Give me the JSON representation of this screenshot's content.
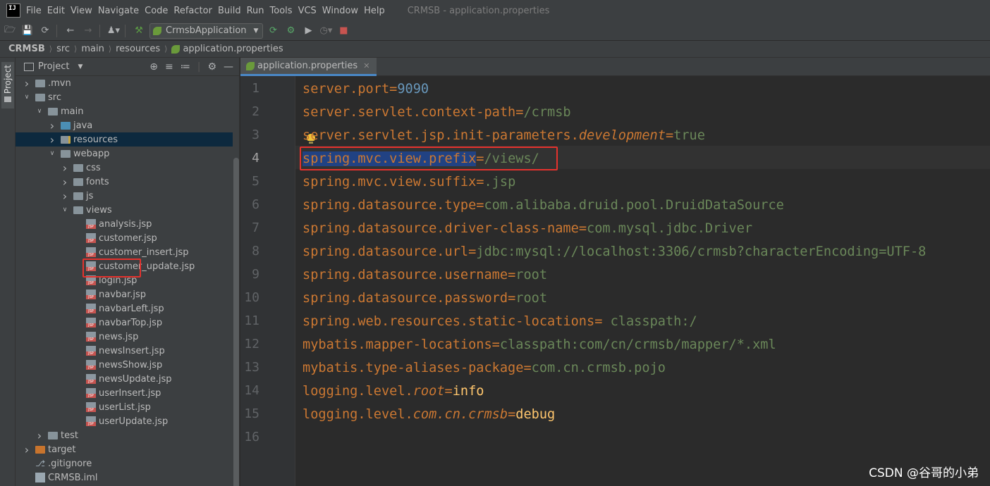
{
  "app": {
    "logo_text": "IJ",
    "window_title": "CRMSB - application.properties"
  },
  "menu": [
    "File",
    "Edit",
    "View",
    "Navigate",
    "Code",
    "Refactor",
    "Build",
    "Run",
    "Tools",
    "VCS",
    "Window",
    "Help"
  ],
  "toolbar": {
    "run_configuration": "CrmsbApplication",
    "icons": [
      "open-icon",
      "save-icon",
      "sync-icon",
      "back-icon",
      "forward-icon",
      "user-icon",
      "build-hammer-icon",
      "rerun-icon",
      "debug-icon",
      "coverage-icon",
      "profile-icon",
      "stop-icon"
    ]
  },
  "breadcrumb": [
    "CRMSB",
    "src",
    "main",
    "resources",
    "application.properties"
  ],
  "side_stripe": {
    "project_label": "Project"
  },
  "project_panel": {
    "title": "Project",
    "tools": [
      "locate-icon",
      "expand-all-icon",
      "collapse-all-icon",
      "gear-icon",
      "hide-icon"
    ],
    "tree": [
      {
        "label": ".mvn",
        "depth": 1,
        "arrow": "right",
        "icon": "folder"
      },
      {
        "label": "src",
        "depth": 1,
        "arrow": "down",
        "icon": "folder"
      },
      {
        "label": "main",
        "depth": 2,
        "arrow": "down",
        "icon": "folder"
      },
      {
        "label": "java",
        "depth": 3,
        "arrow": "right",
        "icon": "folder-blue"
      },
      {
        "label": "resources",
        "depth": 3,
        "arrow": "right",
        "icon": "folder-resources",
        "selected": true
      },
      {
        "label": "webapp",
        "depth": 3,
        "arrow": "down",
        "icon": "folder"
      },
      {
        "label": "css",
        "depth": 4,
        "arrow": "right",
        "icon": "folder"
      },
      {
        "label": "fonts",
        "depth": 4,
        "arrow": "right",
        "icon": "folder"
      },
      {
        "label": "js",
        "depth": 4,
        "arrow": "right",
        "icon": "folder"
      },
      {
        "label": "views",
        "depth": 4,
        "arrow": "down",
        "icon": "folder"
      },
      {
        "label": "analysis.jsp",
        "depth": 5,
        "arrow": "none",
        "icon": "jsp"
      },
      {
        "label": "customer.jsp",
        "depth": 5,
        "arrow": "none",
        "icon": "jsp"
      },
      {
        "label": "customer_insert.jsp",
        "depth": 5,
        "arrow": "none",
        "icon": "jsp"
      },
      {
        "label": "customer_update.jsp",
        "depth": 5,
        "arrow": "none",
        "icon": "jsp"
      },
      {
        "label": "login.jsp",
        "depth": 5,
        "arrow": "none",
        "icon": "jsp"
      },
      {
        "label": "navbar.jsp",
        "depth": 5,
        "arrow": "none",
        "icon": "jsp"
      },
      {
        "label": "navbarLeft.jsp",
        "depth": 5,
        "arrow": "none",
        "icon": "jsp"
      },
      {
        "label": "navbarTop.jsp",
        "depth": 5,
        "arrow": "none",
        "icon": "jsp"
      },
      {
        "label": "news.jsp",
        "depth": 5,
        "arrow": "none",
        "icon": "jsp"
      },
      {
        "label": "newsInsert.jsp",
        "depth": 5,
        "arrow": "none",
        "icon": "jsp"
      },
      {
        "label": "newsShow.jsp",
        "depth": 5,
        "arrow": "none",
        "icon": "jsp"
      },
      {
        "label": "newsUpdate.jsp",
        "depth": 5,
        "arrow": "none",
        "icon": "jsp"
      },
      {
        "label": "userInsert.jsp",
        "depth": 5,
        "arrow": "none",
        "icon": "jsp"
      },
      {
        "label": "userList.jsp",
        "depth": 5,
        "arrow": "none",
        "icon": "jsp"
      },
      {
        "label": "userUpdate.jsp",
        "depth": 5,
        "arrow": "none",
        "icon": "jsp"
      },
      {
        "label": "test",
        "depth": 2,
        "arrow": "right",
        "icon": "folder"
      },
      {
        "label": "target",
        "depth": 1,
        "arrow": "right",
        "icon": "folder-orange"
      },
      {
        "label": ".gitignore",
        "depth": 1,
        "arrow": "none",
        "icon": "git"
      },
      {
        "label": "CRMSB.iml",
        "depth": 1,
        "arrow": "none",
        "icon": "iml"
      }
    ]
  },
  "editor": {
    "tab_label": "application.properties",
    "current_line": 4,
    "lines": [
      {
        "n": "1",
        "key": "server.port",
        "eq": "=",
        "val": "9090"
      },
      {
        "n": "2",
        "key": "server.servlet.context-path",
        "eq": "=",
        "val": "/crmsb"
      },
      {
        "n": "3",
        "key": "server.servlet.jsp.init-parameters.",
        "key_italic": "development",
        "eq": "=",
        "val": "true"
      },
      {
        "n": "4",
        "key": "spring.mvc.view.prefix",
        "eq": "=",
        "val": "/views/"
      },
      {
        "n": "5",
        "key": "spring.mvc.view.suffix",
        "eq": "=",
        "val": ".jsp"
      },
      {
        "n": "6",
        "key": "spring.datasource.type",
        "eq": "=",
        "val": "com.alibaba.druid.pool.DruidDataSource"
      },
      {
        "n": "7",
        "key": "spring.datasource.driver-class-name",
        "eq": "=",
        "val": "com.mysql.jdbc.Driver"
      },
      {
        "n": "8",
        "key": "spring.datasource.url",
        "eq": "=",
        "val": "jdbc:mysql://localhost:3306/crmsb?characterEncoding=UTF-8"
      },
      {
        "n": "9",
        "key": "spring.datasource.username",
        "eq": "=",
        "val": "root"
      },
      {
        "n": "10",
        "key": "spring.datasource.password",
        "eq": "=",
        "val": "root"
      },
      {
        "n": "11",
        "key": "spring.web.resources.static-locations",
        "eq": "=",
        "val": " classpath:/"
      },
      {
        "n": "12",
        "key": "mybatis.mapper-locations",
        "eq": "=",
        "val": "classpath:com/cn/crmsb/mapper/*.xml"
      },
      {
        "n": "13",
        "key": "mybatis.type-aliases-package",
        "eq": "=",
        "val": "com.cn.crmsb.pojo"
      },
      {
        "n": "14",
        "key": "logging.level.",
        "key_italic": "root",
        "eq": "=",
        "val": "info"
      },
      {
        "n": "15",
        "key": "logging.level.",
        "key_italic": "com.cn.crmsb",
        "eq": "=",
        "val": "debug"
      },
      {
        "n": "16",
        "key": "",
        "eq": "",
        "val": ""
      }
    ]
  },
  "watermark": "CSDN @谷哥的小弟",
  "colors": {
    "background": "#2b2b2b",
    "panel": "#3c3f41",
    "key": "#cc7832",
    "value": "#6a8759",
    "number": "#6897bb",
    "selection": "#214283",
    "highlight_box": "#e5322d"
  }
}
